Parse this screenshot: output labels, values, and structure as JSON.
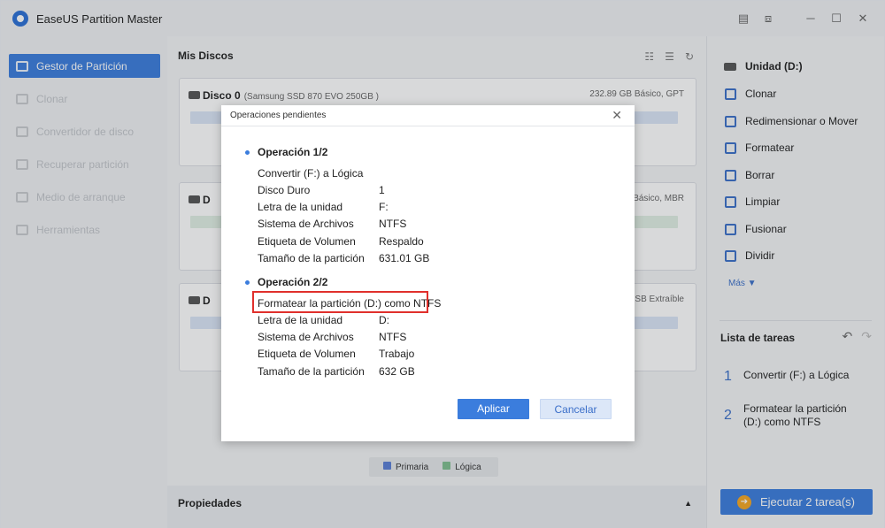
{
  "app": {
    "title": "EaseUS Partition Master"
  },
  "sidebar": {
    "items": [
      {
        "label": "Gestor de Partición",
        "active": true
      },
      {
        "label": "Clonar"
      },
      {
        "label": "Convertidor de disco"
      },
      {
        "label": "Recuperar partición"
      },
      {
        "label": "Medio de arranque"
      },
      {
        "label": "Herramientas"
      }
    ]
  },
  "main": {
    "title": "Mis Discos",
    "disk0": {
      "name": "Disco 0",
      "model": "(Samsung SSD 870 EVO 250GB )",
      "info": "232.89 GB Básico, GPT"
    },
    "disk1": {
      "name": "D",
      "info": "Básico, MBR"
    },
    "disk2": {
      "name": "D",
      "info": "USB Extraíble"
    },
    "legend": {
      "primary": "Primaria",
      "logical": "Lógica"
    },
    "properties": "Propiedades"
  },
  "modal": {
    "title": "Operaciones pendientes",
    "op1": {
      "header": "Operación 1/2",
      "action": "Convertir (F:) a Lógica",
      "rows": [
        {
          "k": "Disco Duro",
          "v": "1"
        },
        {
          "k": "Letra de la unidad",
          "v": "F:"
        },
        {
          "k": "Sistema de Archivos",
          "v": "NTFS"
        },
        {
          "k": "Etiqueta de Volumen",
          "v": "Respaldo"
        },
        {
          "k": "Tamaño de la partición",
          "v": "631.01 GB"
        }
      ]
    },
    "op2": {
      "header": "Operación 2/2",
      "action": "Formatear la partición (D:) como NTFS",
      "rows": [
        {
          "k": "Letra de la unidad",
          "v": "D:"
        },
        {
          "k": "Sistema de Archivos",
          "v": "NTFS"
        },
        {
          "k": "Etiqueta de Volumen",
          "v": "Trabajo"
        },
        {
          "k": "Tamaño de la partición",
          "v": "632 GB"
        }
      ]
    },
    "apply": "Aplicar",
    "cancel": "Cancelar"
  },
  "right": {
    "drive": "Unidad (D:)",
    "actions": [
      "Clonar",
      "Redimensionar o Mover",
      "Formatear",
      "Borrar",
      "Limpiar",
      "Fusionar",
      "Dividir"
    ],
    "more": "Más ▼",
    "tasks_title": "Lista de tareas",
    "tasks": [
      {
        "num": "1",
        "text": "Convertir (F:) a Lógica"
      },
      {
        "num": "2",
        "text": "Formatear la partición (D:) como NTFS"
      }
    ],
    "execute": "Ejecutar 2 tarea(s)"
  },
  "colors": {
    "accent": "#3b7ddd",
    "highlight": "#e0302c",
    "primary": "#5b7fd6",
    "logical": "#7fbf8f"
  }
}
